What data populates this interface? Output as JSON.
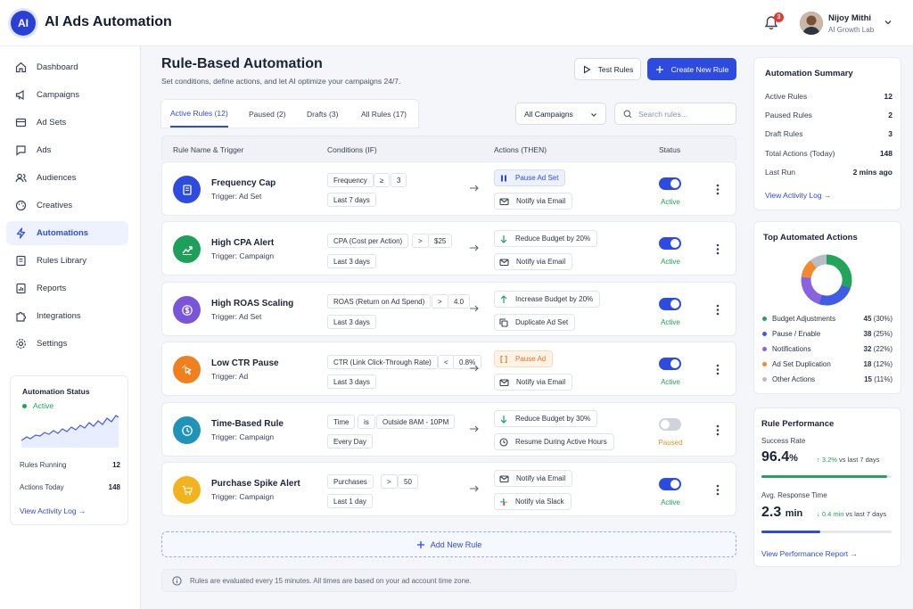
{
  "app": {
    "logo_text": "AI",
    "title": "AI Ads Automation"
  },
  "header": {
    "notification_count": "3",
    "user_name": "Nijoy Mithi",
    "user_org": "AI Growth Lab"
  },
  "sidebar": {
    "items": [
      {
        "label": "Dashboard",
        "icon": "home-icon"
      },
      {
        "label": "Campaigns",
        "icon": "megaphone-icon"
      },
      {
        "label": "Ad Sets",
        "icon": "layers-icon"
      },
      {
        "label": "Ads",
        "icon": "ad-icon"
      },
      {
        "label": "Audiences",
        "icon": "users-icon"
      },
      {
        "label": "Creatives",
        "icon": "palette-icon"
      },
      {
        "label": "Automations",
        "icon": "bolt-icon",
        "active": true
      },
      {
        "label": "Rules Library",
        "icon": "book-icon"
      },
      {
        "label": "Reports",
        "icon": "report-icon"
      },
      {
        "label": "Integrations",
        "icon": "puzzle-icon"
      },
      {
        "label": "Settings",
        "icon": "gear-icon"
      }
    ],
    "status": {
      "title": "Automation Status",
      "state": "Active",
      "rules_running_label": "Rules Running",
      "rules_running": "12",
      "actions_today_label": "Actions Today",
      "actions_today": "148",
      "link": "View Activity Log →"
    }
  },
  "main": {
    "title": "Rule-Based Automation",
    "subtitle": "Set conditions, define actions, and let AI optimize your campaigns 24/7.",
    "test_button": "Test Rules",
    "create_button": "Create New Rule",
    "tabs": [
      "Active Rules (12)",
      "Paused (2)",
      "Drafts (3)",
      "All Rules (17)"
    ],
    "campaign_filter": "All Campaigns",
    "search_placeholder": "Search rules...",
    "columns": [
      "Rule Name & Trigger",
      "Conditions (IF)",
      "Actions (THEN)",
      "Status"
    ],
    "rules": [
      {
        "name": "Frequency Cap",
        "trigger": "Trigger: Ad Set",
        "icon": "document-icon",
        "color": "#2d4be0",
        "cond": [
          "Frequency",
          "≥",
          "3"
        ],
        "period": "Last 7 days",
        "actions": [
          {
            "label": "Pause Ad Set",
            "icon": "pause-icon",
            "hl": "blue"
          },
          {
            "label": "Notify via Email",
            "icon": "mail-icon"
          }
        ],
        "status": "Active",
        "on": true
      },
      {
        "name": "High CPA Alert",
        "trigger": "Trigger: Campaign",
        "icon": "chart-icon",
        "color": "#1ea05a",
        "cond": [
          "CPA (Cost per Action)",
          ">",
          "$25"
        ],
        "period": "Last 3 days",
        "actions": [
          {
            "label": "Reduce Budget by 20%",
            "icon": "arrow-down-icon"
          },
          {
            "label": "Notify via Email",
            "icon": "mail-icon"
          }
        ],
        "status": "Active",
        "on": true
      },
      {
        "name": "High ROAS Scaling",
        "trigger": "Trigger: Ad Set",
        "icon": "dollar-icon",
        "color": "#7b55d9",
        "cond": [
          "ROAS (Return on Ad Spend)",
          ">",
          "4.0"
        ],
        "period": "Last 3 days",
        "actions": [
          {
            "label": "Increase Budget by 20%",
            "icon": "arrow-up-icon"
          },
          {
            "label": "Duplicate Ad Set",
            "icon": "copy-icon"
          }
        ],
        "status": "Active",
        "on": true
      },
      {
        "name": "Low CTR Pause",
        "trigger": "Trigger: Ad",
        "icon": "cursor-icon",
        "color": "#f07f1e",
        "cond": [
          "CTR (Link Click-Through Rate)",
          "<",
          "0.8%"
        ],
        "period": "Last 3 days",
        "actions": [
          {
            "label": "Pause Ad",
            "icon": "bracket-icon",
            "hl": "orange"
          },
          {
            "label": "Notify via Email",
            "icon": "mail-icon"
          }
        ],
        "status": "Active",
        "on": true
      },
      {
        "name": "Time-Based Rule",
        "trigger": "Trigger: Campaign",
        "icon": "clock-icon",
        "color": "#1f93b8",
        "cond": [
          "Time",
          "is",
          "Outside 8AM - 10PM"
        ],
        "period": "Every Day",
        "actions": [
          {
            "label": "Reduce Budget by 30%",
            "icon": "arrow-down-icon"
          },
          {
            "label": "Resume During Active Hours",
            "icon": "clock-icon"
          }
        ],
        "status": "Paused",
        "on": false
      },
      {
        "name": "Purchase Spike Alert",
        "trigger": "Trigger: Campaign",
        "icon": "cart-icon",
        "color": "#f2b31c",
        "cond": [
          "Purchases",
          ">",
          "50"
        ],
        "period": "Last 1 day",
        "actions": [
          {
            "label": "Notify via Email",
            "icon": "mail-icon"
          },
          {
            "label": "Notify via Slack",
            "icon": "slack-icon"
          }
        ],
        "status": "Active",
        "on": true
      }
    ],
    "add_rule": "Add New Rule",
    "info": "Rules are evaluated every 15 minutes. All times are based on your ad account time zone."
  },
  "summary": {
    "title": "Automation Summary",
    "rows": [
      {
        "label": "Active Rules",
        "value": "12"
      },
      {
        "label": "Paused Rules",
        "value": "2"
      },
      {
        "label": "Draft Rules",
        "value": "3"
      },
      {
        "label": "Total Actions (Today)",
        "value": "148"
      },
      {
        "label": "Last Run",
        "value": "2 mins ago"
      }
    ],
    "link": "View Activity Log →"
  },
  "top_actions": {
    "title": "Top Automated Actions",
    "items": [
      {
        "label": "Budget Adjustments",
        "count": "45",
        "pct": "(30%)",
        "share": 30,
        "color": "#22a45a"
      },
      {
        "label": "Pause / Enable",
        "count": "38",
        "pct": "(25%)",
        "share": 25,
        "color": "#3f5ce6"
      },
      {
        "label": "Notifications",
        "count": "32",
        "pct": "(22%)",
        "share": 22,
        "color": "#8a63e0"
      },
      {
        "label": "Ad Set Duplication",
        "count": "18",
        "pct": "(12%)",
        "share": 12,
        "color": "#f08a2a"
      },
      {
        "label": "Other Actions",
        "count": "15",
        "pct": "(11%)",
        "share": 11,
        "color": "#b8bdc8"
      }
    ]
  },
  "performance": {
    "title": "Rule Performance",
    "success_label": "Success Rate",
    "success_value": "96.4",
    "success_unit": "%",
    "success_delta": "↑ 3.2%",
    "success_delta_note": "vs last 7 days",
    "success_fraction": 0.964,
    "response_label": "Avg. Response Time",
    "response_value": "2.3",
    "response_unit": "min",
    "response_delta": "↓ 0.4 min",
    "response_delta_note": "vs last 7 days",
    "response_fraction": 0.45,
    "link": "View Performance Report →"
  }
}
